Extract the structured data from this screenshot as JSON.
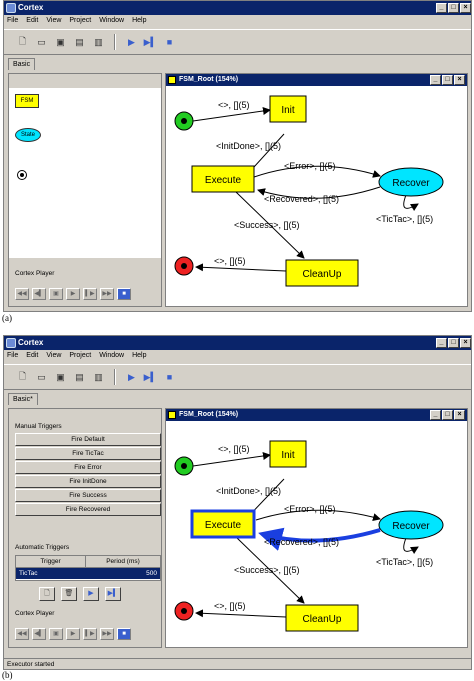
{
  "captions": {
    "a": "(a)",
    "b": "(b)"
  },
  "app": {
    "title": "Cortex",
    "menu": [
      "File",
      "Edit",
      "View",
      "Project",
      "Window",
      "Help"
    ],
    "window_buttons": [
      "_",
      "□",
      "×"
    ]
  },
  "tabs": {
    "a": "Basic",
    "b": "Basic*"
  },
  "inner_window": {
    "title": "FSM_Root (154%)"
  },
  "palette": {
    "fsm": "FSM",
    "state": "State"
  },
  "player": {
    "label": "Cortex Player"
  },
  "manual_triggers": {
    "label": "Manual Triggers",
    "buttons": [
      "Fire Default",
      "Fire TicTac",
      "Fire Error",
      "Fire InitDone",
      "Fire Success",
      "Fire Recovered"
    ]
  },
  "automatic_triggers": {
    "label": "Automatic Triggers",
    "columns": [
      "Trigger",
      "Period (ms)"
    ],
    "rows": [
      {
        "trigger": "TicTac",
        "period": "500"
      }
    ]
  },
  "status": {
    "b": "Executor started"
  },
  "fsm": {
    "states": {
      "init": "Init",
      "execute": "Execute",
      "recover": "Recover",
      "cleanup": "CleanUp"
    },
    "transitions": {
      "start": "<>, [](5)",
      "init_done": "<InitDone>, [](5)",
      "error": "<Error>, [](5)",
      "recovered": "<Recovered>, [](5)",
      "tictac": "<TicTac>, [](5)",
      "success": "<Success>, [](5)",
      "end": "<>, [](5)"
    }
  },
  "colors": {
    "state_fill": "#ffff00",
    "recover_fill": "#00e5ff",
    "start_node": "#22cc22",
    "end_node": "#ee2222",
    "titlebar": "#0a246a",
    "active_highlight": "#1a3fe0"
  }
}
